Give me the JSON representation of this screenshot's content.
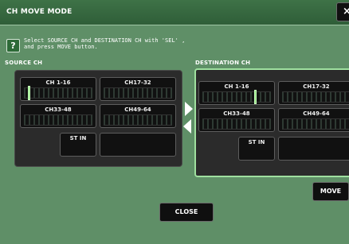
{
  "window": {
    "title": "CH MOVE MODE",
    "close_glyph": "×"
  },
  "instruction": {
    "icon": "help-icon",
    "icon_glyph": "?",
    "line1": "Select SOURCE CH and DESTINATION CH with 'SEL' ,",
    "line2": "and press MOVE button."
  },
  "source": {
    "label": "SOURCE CH",
    "boxes": [
      "CH 1-16",
      "CH17-32",
      "CH33-48",
      "CH49-64",
      "ST IN"
    ]
  },
  "destination": {
    "label": "DESTINATION CH",
    "boxes": [
      "CH 1-16",
      "CH17-32",
      "CH33-48",
      "CH49-64",
      "ST IN"
    ]
  },
  "arrows": {
    "right_icon": "arrow-right-icon",
    "left_icon": "arrow-left-icon"
  },
  "buttons": {
    "move": "MOVE",
    "close": "CLOSE"
  },
  "colors": {
    "background": "#5f8f67",
    "highlight": "#9fe09f",
    "selected_strip": "#8fe07a"
  }
}
